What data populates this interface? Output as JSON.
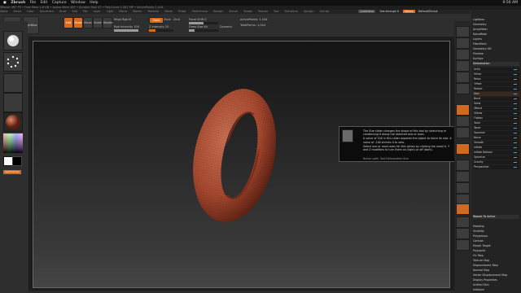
{
  "menubar": {
    "app": "ZBrush",
    "items": [
      "Zbrush",
      "File",
      "Edit",
      "Capture",
      "Window",
      "Help"
    ],
    "clock": "9:56 AM"
  },
  "titlebar": {
    "text": "ZBrush 4R7 P3 • Free Mem 2.6 GB • Active Mem 487 • Scratch Disk 47 • PolyCount 1.061 MP • ActivePoints 1,044"
  },
  "toprightmenus": {
    "quicksave": "QuickSave",
    "seethrough": "See-through 0",
    "menus": "Menus",
    "defaultscript": "DefaultZScript"
  },
  "palette_bar": [
    "Alpha",
    "Brush",
    "Color",
    "Document",
    "Draw",
    "Edit",
    "File",
    "Layer",
    "Light",
    "Macro",
    "Marker",
    "Material",
    "Movie",
    "Picker",
    "Preferences",
    "Render",
    "Stencil",
    "Stroke",
    "Texture",
    "Tool",
    "Transform",
    "Zplugin",
    "Zscript"
  ],
  "shelf": {
    "projection_label": "Projection Master",
    "lightbox_label": "LightBox",
    "edit_label": "Edit",
    "draw_label": "Draw",
    "move_label": "Move",
    "scale_label": "Scale",
    "rotate_label": "Rotate",
    "mrgb": "Mrgb",
    "rgb": "Rgb",
    "m": "M",
    "zadd": "Zadd",
    "zsub": "Zsub",
    "zcut": "Zcut",
    "focal_label": "Focal Shift 0",
    "draw_size_label": "Draw Size 64",
    "dynamic_label": "Dynamic",
    "z_intensity_label": "Z Intensity 25",
    "rgb_intensity_label": "Rgb Intensity 100",
    "active_points": "ActivePoints: 1,044",
    "total_points": "TotalPoints: 1,044"
  },
  "right_panel": {
    "items": [
      "Lightbox",
      "Geometry",
      "ArrayMesh",
      "NanoMesh",
      "Layers",
      "FiberMesh",
      "Geometry HD",
      "Preview",
      "Surface"
    ],
    "deformation_header": "Deformation",
    "sliders": [
      "Unify",
      "Mirror",
      "Relax",
      "Offset",
      "Rotate",
      "Size",
      "Bend",
      "Skew",
      "SBend",
      "SSkew",
      "Flatten",
      "Twist",
      "Taper",
      "Squeeze",
      "Noise",
      "Smooth",
      "Inflate",
      "Inflate Balloon",
      "Spherize",
      "Gravity",
      "Perspective"
    ],
    "bottom_items": [
      "Repeat To Active",
      "Masking",
      "Visibility",
      "Polygroups",
      "Contact",
      "Morph Target",
      "Polypaint",
      "UV Map",
      "Texture Map",
      "Displacement Map",
      "Normal Map",
      "Vector Displacement Map",
      "Display Properties",
      "Unified Skin",
      "Initialize"
    ]
  },
  "tooltip": {
    "para1": "The Size slider changes the shape of this tool by stretching or condensing it along the selected axis or axes.",
    "para2": "A value of 100 in this slider expands the object to twice its size. A value of -100 shrinks it to zero.",
    "para3": "Select one or more axes for this action by clicking the small X, Y and Z modifiers to turn them on (light) or off (dark).",
    "path": "Button path: Tool:Deformation:Size"
  },
  "left_tray": {
    "switch_label": "SwitchColor"
  },
  "colors": {
    "accent": "#d96a1d",
    "model": "#b55a3f"
  }
}
